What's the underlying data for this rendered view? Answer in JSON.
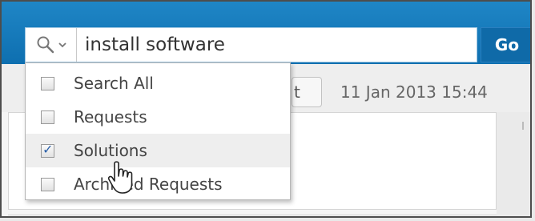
{
  "search": {
    "value": "install software",
    "go_label": "Go"
  },
  "toolbar": {
    "nav_button_label": "t",
    "timestamp": "11 Jan 2013 15:44"
  },
  "dropdown": {
    "items": [
      {
        "label": "Search All",
        "checked": false
      },
      {
        "label": "Requests",
        "checked": false
      },
      {
        "label": "Solutions",
        "checked": true
      },
      {
        "label": "Archived Requests",
        "checked": false
      }
    ]
  },
  "icons": {
    "search": "search-icon",
    "dropdown": "chevron-down-icon",
    "cursor": "hand-pointer-icon"
  },
  "colors": {
    "header": "#1479bb",
    "go_button": "#0f6aa8",
    "checkmark": "#2a5fa8"
  }
}
